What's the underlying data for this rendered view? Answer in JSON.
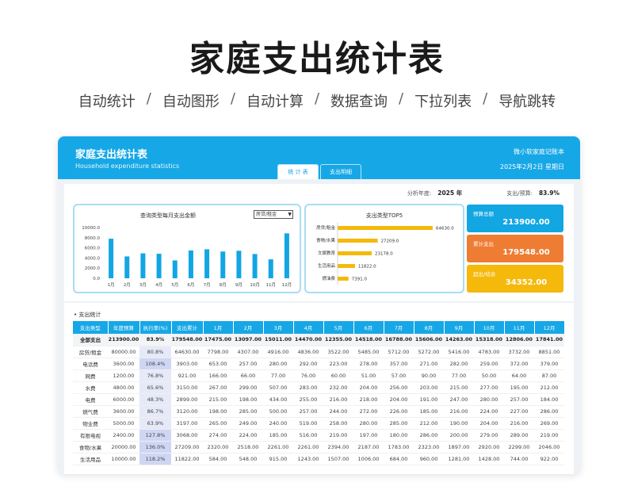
{
  "hero": {
    "title": "家庭支出统计表",
    "features": [
      "自动统计",
      "自动图形",
      "自动计算",
      "数据查询",
      "下拉列表",
      "导航跳转"
    ]
  },
  "header": {
    "title": "家庭支出统计表",
    "subtitle": "Household expenditure statistics",
    "brand": "微小软家庭记账本",
    "date": "2025年2月2日  星期日",
    "tabs": [
      {
        "label": "统 计 表",
        "active": true
      },
      {
        "label": "支出明细",
        "active": false
      }
    ]
  },
  "filters": {
    "year_label": "分析年度:",
    "year_value": "2025 年",
    "ratio_label": "支出/预算:",
    "ratio_value": "83.9%"
  },
  "monthly_chart": {
    "title": "查询类型每月支出金额",
    "selector_value": "房贷/租金",
    "selector_arrow": "▼"
  },
  "top5_chart": {
    "title": "支出类型TOP5"
  },
  "kpis": [
    {
      "label": "预算总额",
      "value": "213900.00",
      "color": "#12a6e3"
    },
    {
      "label": "累计支出",
      "value": "179548.00",
      "color": "#ef7c33"
    },
    {
      "label": "超出/结余",
      "value": "34352.00",
      "color": "#f5b90c"
    }
  ],
  "chart_data": [
    {
      "type": "bar",
      "categories": [
        "1月",
        "2月",
        "3月",
        "4月",
        "5月",
        "6月",
        "7月",
        "8月",
        "9月",
        "10月",
        "11月",
        "12月"
      ],
      "values": [
        7798,
        4307,
        4916,
        4836,
        3522,
        5485,
        5712,
        5272,
        5416,
        4783,
        3732,
        8851
      ],
      "ylim": [
        0,
        10000
      ],
      "yticks": [
        "0.0",
        "2000.0",
        "4000.0",
        "6000.0",
        "8000.0",
        "10000.0"
      ],
      "grid": false,
      "color": "#12a6e3"
    },
    {
      "type": "bar",
      "orientation": "horizontal",
      "categories": [
        "房贷/租金",
        "食物/水果",
        "文娱教育",
        "生活用品",
        "燃油费"
      ],
      "values": [
        64630.0,
        27209.0,
        23178.0,
        11822.0,
        7391.0
      ],
      "value_labels": [
        "64630.0",
        "27209.0",
        "23178.0",
        "11822.0",
        "7391.0"
      ],
      "color": "#f5b90c"
    }
  ],
  "table": {
    "section_title": "• 支出统计",
    "columns": [
      "支出类型",
      "年度预算",
      "执行率(%)",
      "支出累计",
      "1月",
      "2月",
      "3月",
      "4月",
      "5月",
      "6月",
      "7月",
      "8月",
      "9月",
      "10月",
      "11月",
      "12月"
    ],
    "total": [
      "全部支出",
      "213900.00",
      "83.9%",
      "179548.00",
      "17475.00",
      "13097.00",
      "15011.00",
      "14470.00",
      "12355.00",
      "14518.00",
      "16788.00",
      "15606.00",
      "14263.00",
      "15318.00",
      "12806.00",
      "17841.00"
    ],
    "rows": [
      [
        "房贷/租金",
        "80000.00",
        "80.8%",
        "64630.00",
        "7798.00",
        "4307.00",
        "4916.00",
        "4836.00",
        "3522.00",
        "5485.00",
        "5712.00",
        "5272.00",
        "5416.00",
        "4783.00",
        "3732.00",
        "8851.00"
      ],
      [
        "电话费",
        "3600.00",
        "108.4%",
        "3903.00",
        "653.00",
        "257.00",
        "280.00",
        "292.00",
        "223.00",
        "278.00",
        "357.00",
        "271.00",
        "282.00",
        "259.00",
        "372.00",
        "379.00"
      ],
      [
        "网费",
        "1200.00",
        "76.8%",
        "921.00",
        "166.00",
        "66.00",
        "77.00",
        "76.00",
        "60.00",
        "51.00",
        "57.00",
        "90.00",
        "77.00",
        "50.00",
        "64.00",
        "87.00"
      ],
      [
        "水费",
        "4800.00",
        "65.6%",
        "3150.00",
        "267.00",
        "299.00",
        "507.00",
        "283.00",
        "232.00",
        "204.00",
        "256.00",
        "203.00",
        "215.00",
        "277.00",
        "195.00",
        "212.00"
      ],
      [
        "电费",
        "6000.00",
        "48.3%",
        "2899.00",
        "215.00",
        "198.00",
        "434.00",
        "255.00",
        "216.00",
        "218.00",
        "204.00",
        "191.00",
        "247.00",
        "280.00",
        "257.00",
        "184.00"
      ],
      [
        "燃气费",
        "3600.00",
        "86.7%",
        "3120.00",
        "198.00",
        "285.00",
        "500.00",
        "257.00",
        "244.00",
        "272.00",
        "226.00",
        "185.00",
        "216.00",
        "224.00",
        "227.00",
        "286.00"
      ],
      [
        "物业费",
        "5000.00",
        "63.9%",
        "3197.00",
        "265.00",
        "249.00",
        "240.00",
        "519.00",
        "258.00",
        "280.00",
        "285.00",
        "212.00",
        "190.00",
        "204.00",
        "216.00",
        "269.00"
      ],
      [
        "有限电视",
        "2400.00",
        "127.8%",
        "3068.00",
        "274.00",
        "224.00",
        "185.00",
        "516.00",
        "219.00",
        "197.00",
        "180.00",
        "286.00",
        "200.00",
        "279.00",
        "289.00",
        "219.00"
      ],
      [
        "食物/水果",
        "20000.00",
        "136.0%",
        "27209.00",
        "2320.00",
        "2518.00",
        "2261.00",
        "2261.00",
        "2394.00",
        "2187.00",
        "1783.00",
        "2323.00",
        "1897.00",
        "2920.00",
        "2299.00",
        "2046.00"
      ],
      [
        "生活用品",
        "10000.00",
        "118.2%",
        "11822.00",
        "584.00",
        "548.00",
        "915.00",
        "1243.00",
        "1507.00",
        "1006.00",
        "684.00",
        "960.00",
        "1281.00",
        "1428.00",
        "744.00",
        "922.00"
      ]
    ]
  }
}
